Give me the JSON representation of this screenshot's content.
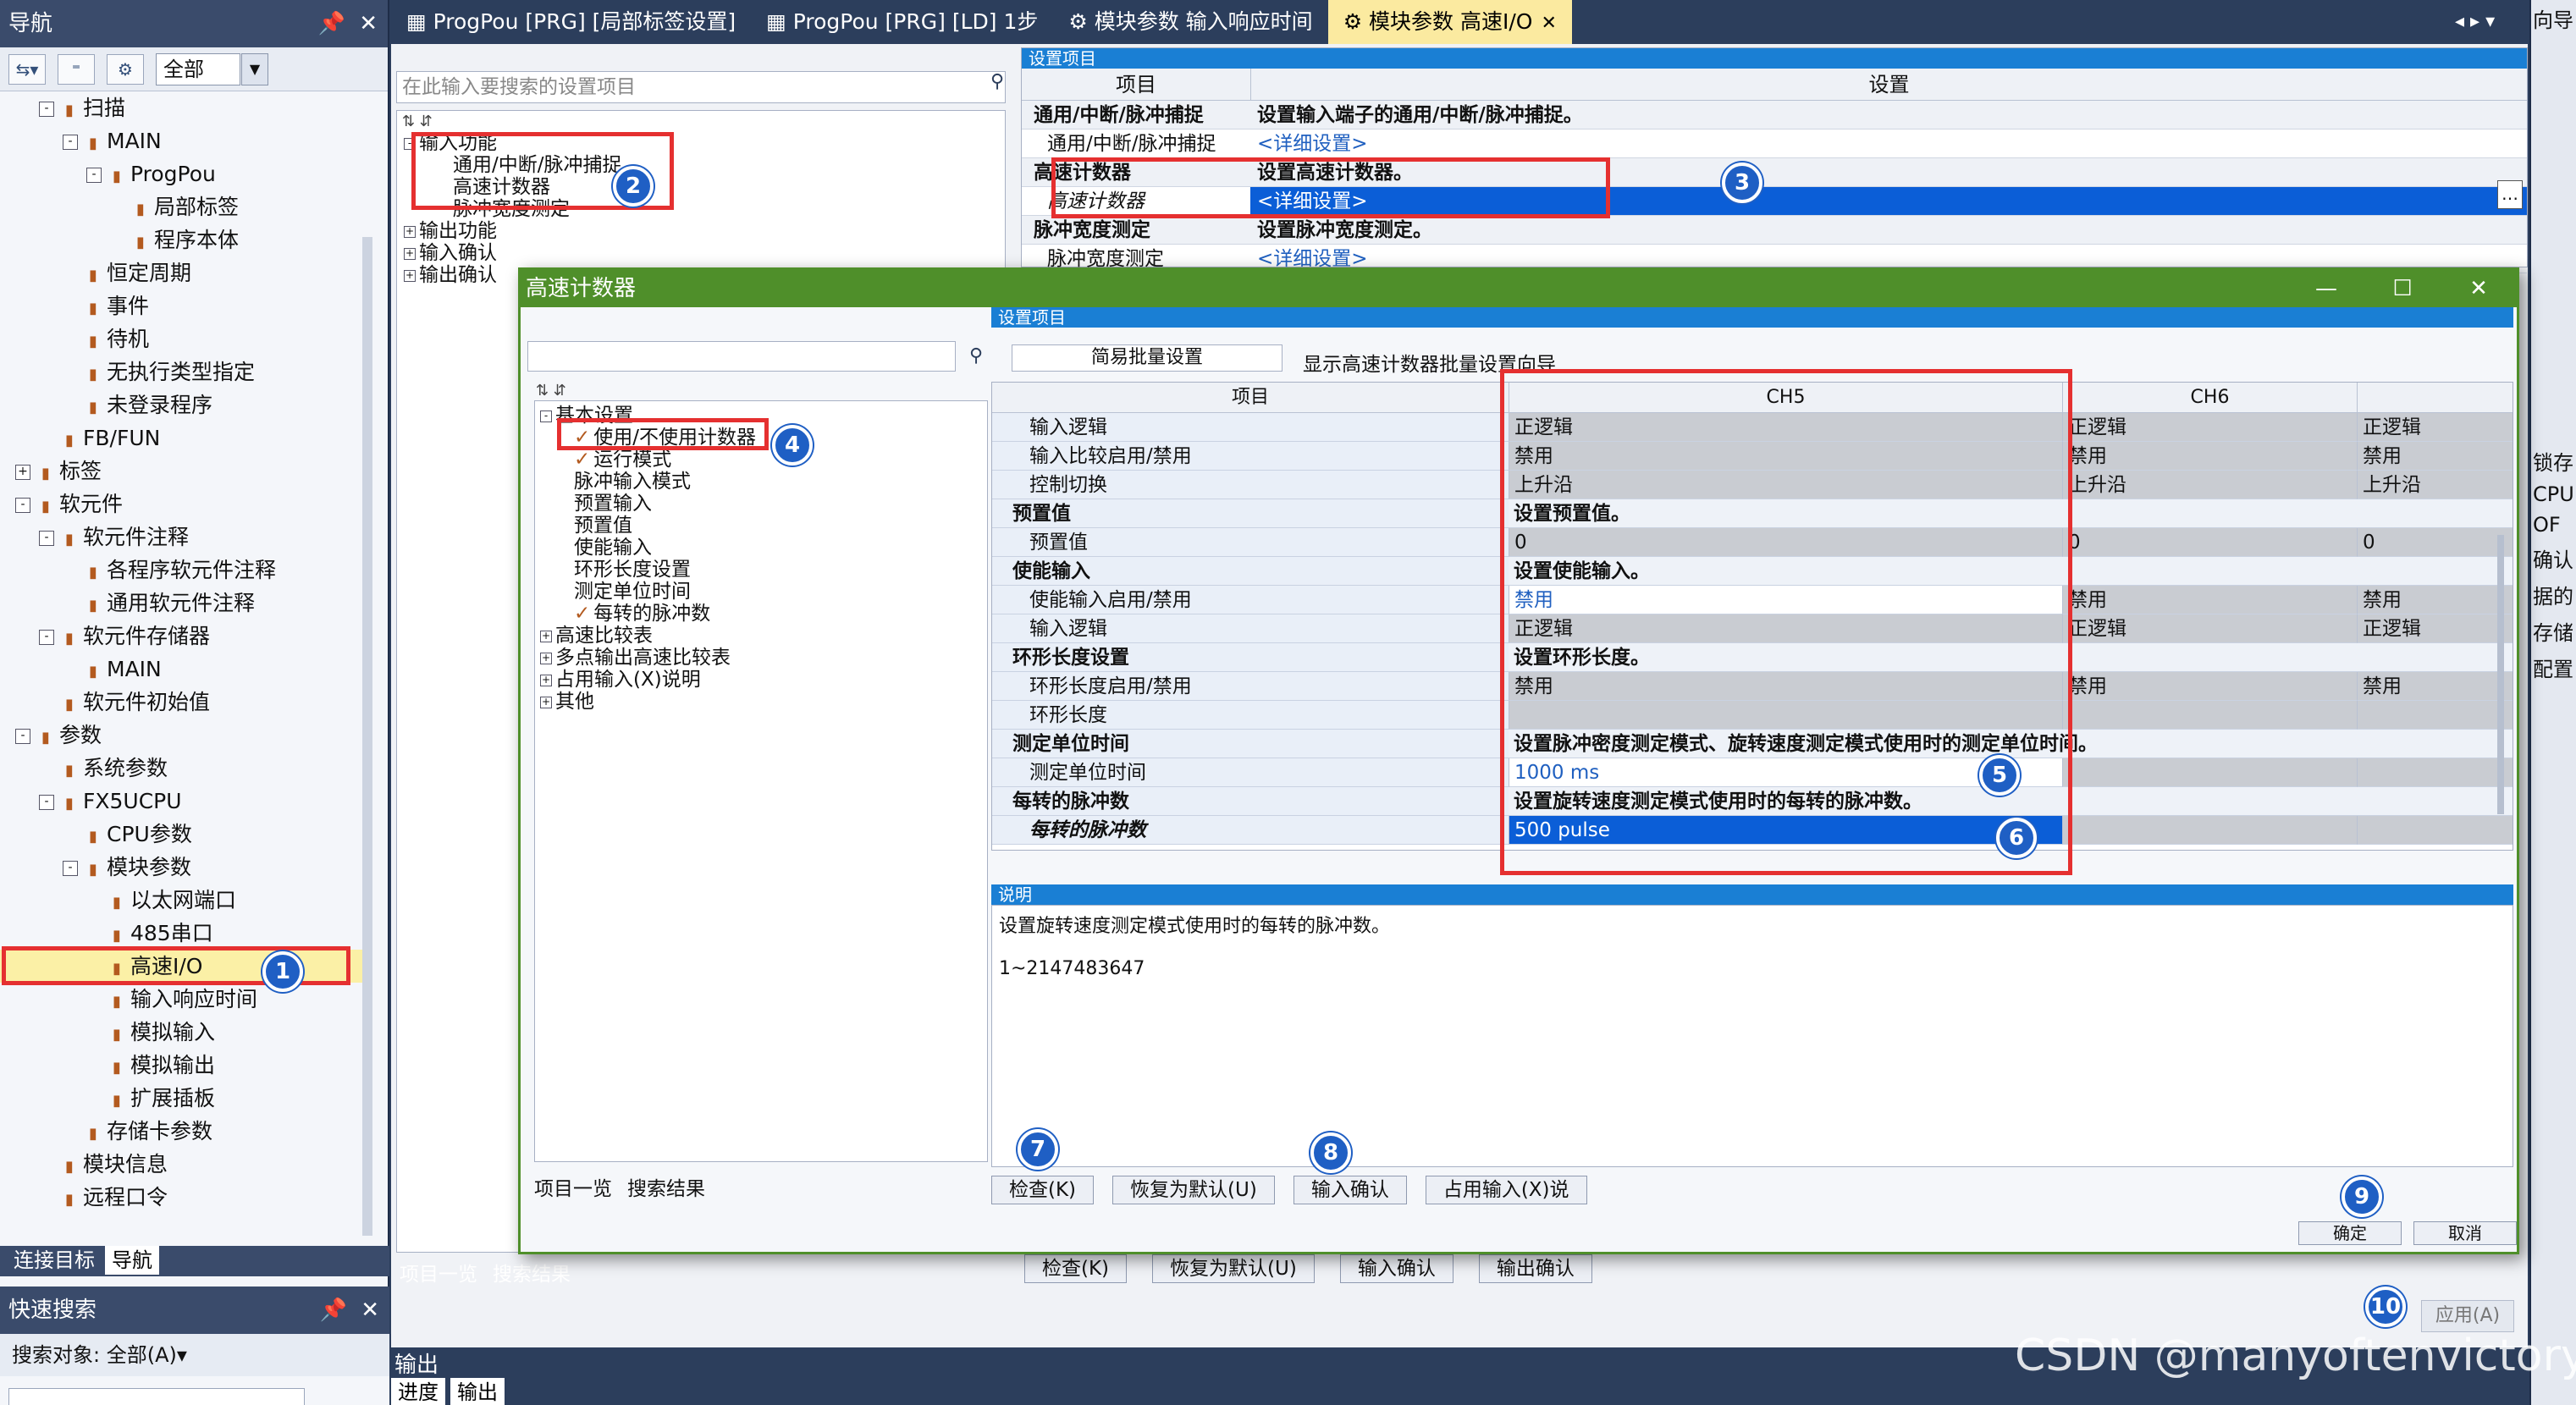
{
  "nav": {
    "title": "导航",
    "filter_value": "全部",
    "tree": [
      {
        "label": "扫描",
        "level": 1,
        "exp": "-"
      },
      {
        "label": "MAIN",
        "level": 2,
        "exp": "-"
      },
      {
        "label": "ProgPou",
        "level": 3,
        "exp": "-"
      },
      {
        "label": "局部标签",
        "level": 4,
        "exp": ""
      },
      {
        "label": "程序本体",
        "level": 4,
        "exp": ""
      },
      {
        "label": "恒定周期",
        "level": 2,
        "exp": ""
      },
      {
        "label": "事件",
        "level": 2,
        "exp": ""
      },
      {
        "label": "待机",
        "level": 2,
        "exp": ""
      },
      {
        "label": "无执行类型指定",
        "level": 2,
        "exp": ""
      },
      {
        "label": "未登录程序",
        "level": 2,
        "exp": ""
      },
      {
        "label": "FB/FUN",
        "level": 1,
        "exp": ""
      },
      {
        "label": "标签",
        "level": 0,
        "exp": "+"
      },
      {
        "label": "软元件",
        "level": 0,
        "exp": "-"
      },
      {
        "label": "软元件注释",
        "level": 1,
        "exp": "-"
      },
      {
        "label": "各程序软元件注释",
        "level": 2,
        "exp": ""
      },
      {
        "label": "通用软元件注释",
        "level": 2,
        "exp": ""
      },
      {
        "label": "软元件存储器",
        "level": 1,
        "exp": "-"
      },
      {
        "label": "MAIN",
        "level": 2,
        "exp": ""
      },
      {
        "label": "软元件初始值",
        "level": 1,
        "exp": ""
      },
      {
        "label": "参数",
        "level": 0,
        "exp": "-"
      },
      {
        "label": "系统参数",
        "level": 1,
        "exp": ""
      },
      {
        "label": "FX5UCPU",
        "level": 1,
        "exp": "-"
      },
      {
        "label": "CPU参数",
        "level": 2,
        "exp": ""
      },
      {
        "label": "模块参数",
        "level": 2,
        "exp": "-"
      },
      {
        "label": "以太网端口",
        "level": 3,
        "exp": ""
      },
      {
        "label": "485串口",
        "level": 3,
        "exp": ""
      },
      {
        "label": "高速I/O",
        "level": 3,
        "exp": "",
        "selected": true
      },
      {
        "label": "输入响应时间",
        "level": 3,
        "exp": ""
      },
      {
        "label": "模拟输入",
        "level": 3,
        "exp": ""
      },
      {
        "label": "模拟输出",
        "level": 3,
        "exp": ""
      },
      {
        "label": "扩展插板",
        "level": 3,
        "exp": ""
      },
      {
        "label": "存储卡参数",
        "level": 2,
        "exp": ""
      },
      {
        "label": "模块信息",
        "level": 1,
        "exp": ""
      },
      {
        "label": "远程口令",
        "level": 1,
        "exp": ""
      }
    ],
    "bottom_tabs": [
      "连接目标",
      "导航"
    ],
    "quick_search_title": "快速搜索",
    "search_target": "搜索对象: 全部(A)▾"
  },
  "tabs": [
    {
      "label": "ProgPou [PRG] [局部标签设置]",
      "active": false
    },
    {
      "label": "ProgPou [PRG] [LD] 1步",
      "active": false
    },
    {
      "label": "模块参数 输入响应时间",
      "active": false
    },
    {
      "label": "模块参数 高速I/O",
      "active": true
    }
  ],
  "base": {
    "search_placeholder": "在此输入要搜索的设置项目",
    "section_label": "设置项目",
    "tree": [
      {
        "label": "输入功能",
        "exp": "-",
        "indent": 0
      },
      {
        "label": "通用/中断/脉冲捕捉",
        "exp": "",
        "indent": 1
      },
      {
        "label": "高速计数器",
        "exp": "",
        "indent": 1
      },
      {
        "label": "脉冲宽度测定",
        "exp": "",
        "indent": 1
      },
      {
        "label": "输出功能",
        "exp": "+",
        "indent": 0
      },
      {
        "label": "输入确认",
        "exp": "+",
        "indent": 0
      },
      {
        "label": "输出确认",
        "exp": "+",
        "indent": 0
      }
    ],
    "grid_header": [
      "项目",
      "设置"
    ],
    "grid_rows": [
      {
        "item": "通用/中断/脉冲捕捉",
        "value": "设置输入端子的通用/中断/脉冲捕捉。",
        "group": true
      },
      {
        "item": "通用/中断/脉冲捕捉",
        "value": "<详细设置>",
        "link": true
      },
      {
        "item": "高速计数器",
        "value": "设置高速计数器。",
        "group": true
      },
      {
        "item": "高速计数器",
        "value": "<详细设置>",
        "link": true,
        "highlight": true
      },
      {
        "item": "脉冲宽度测定",
        "value": "设置脉冲宽度测定。",
        "group": true
      },
      {
        "item": "脉冲宽度测定",
        "value": "<详细设置>",
        "link": true
      }
    ],
    "bottom_tabs": [
      "项目一览",
      "搜索结果"
    ],
    "buttons": [
      "检查(K)",
      "恢复为默认(U)",
      "输入确认",
      "输出确认"
    ],
    "apply": "应用(A)"
  },
  "dialog": {
    "title": "高速计数器",
    "section_label": "设置项目",
    "batch_button": "简易批量设置",
    "batch_text": "显示高速计数器批量设置向导",
    "tree": [
      {
        "label": "基本设置",
        "exp": "-",
        "indent": 0,
        "check": false
      },
      {
        "label": "使用/不使用计数器",
        "exp": "",
        "indent": 1,
        "check": true
      },
      {
        "label": "运行模式",
        "exp": "",
        "indent": 1,
        "check": true
      },
      {
        "label": "脉冲输入模式",
        "exp": "",
        "indent": 1,
        "check": false
      },
      {
        "label": "预置输入",
        "exp": "",
        "indent": 1,
        "check": false
      },
      {
        "label": "预置值",
        "exp": "",
        "indent": 1,
        "check": false
      },
      {
        "label": "使能输入",
        "exp": "",
        "indent": 1,
        "check": false
      },
      {
        "label": "环形长度设置",
        "exp": "",
        "indent": 1,
        "check": false
      },
      {
        "label": "测定单位时间",
        "exp": "",
        "indent": 1,
        "check": false
      },
      {
        "label": "每转的脉冲数",
        "exp": "",
        "indent": 1,
        "check": true
      },
      {
        "label": "高速比较表",
        "exp": "+",
        "indent": 0,
        "check": false
      },
      {
        "label": "多点输出高速比较表",
        "exp": "+",
        "indent": 0,
        "check": false
      },
      {
        "label": "占用输入(X)说明",
        "exp": "+",
        "indent": 0,
        "check": false
      },
      {
        "label": "其他",
        "exp": "+",
        "indent": 0,
        "check": false
      }
    ],
    "bottom_tabs": [
      "项目一览",
      "搜索结果"
    ],
    "grid_header": {
      "item": "项目",
      "ch5": "CH5",
      "ch6": "CH6"
    },
    "grid_rows": [
      {
        "item": "输入逻辑",
        "ch5": "正逻辑",
        "ch6": "正逻辑",
        "ch7": "正逻辑"
      },
      {
        "item": "输入比较启用/禁用",
        "ch5": "禁用",
        "ch6": "禁用",
        "ch7": "禁用"
      },
      {
        "item": "控制切换",
        "ch5": "上升沿",
        "ch6": "上升沿",
        "ch7": "上升沿"
      },
      {
        "item": "预置值",
        "desc": "设置预置值。",
        "group": true
      },
      {
        "item": "预置值",
        "ch5": "0",
        "ch6": "0",
        "ch7": "0"
      },
      {
        "item": "使能输入",
        "desc": "设置使能输入。",
        "group": true
      },
      {
        "item": "使能输入启用/禁用",
        "ch5": "禁用",
        "ch6": "禁用",
        "ch7": "禁用",
        "style": "white"
      },
      {
        "item": "输入逻辑",
        "ch5": "正逻辑",
        "ch6": "正逻辑",
        "ch7": "正逻辑"
      },
      {
        "item": "环形长度设置",
        "desc": "设置环形长度。",
        "group": true
      },
      {
        "item": "环形长度启用/禁用",
        "ch5": "禁用",
        "ch6": "禁用",
        "ch7": "禁用"
      },
      {
        "item": "环形长度",
        "ch5": "",
        "ch6": "",
        "ch7": ""
      },
      {
        "item": "测定单位时间",
        "desc": "设置脉冲密度测定模式、旋转速度测定模式使用时的测定单位时间。",
        "group": true
      },
      {
        "item": "测定单位时间",
        "ch5": "1000 ms",
        "ch6": "",
        "ch7": "",
        "style": "white"
      },
      {
        "item": "每转的脉冲数",
        "desc": "设置旋转速度测定模式使用时的每转的脉冲数。",
        "group": true
      },
      {
        "item": "每转的脉冲数",
        "ch5": "500 pulse",
        "ch6": "",
        "ch7": "",
        "style": "blue",
        "italic": true
      }
    ],
    "desc_label": "说明",
    "desc_line1": "设置旋转速度测定模式使用时的每转的脉冲数。",
    "desc_line2": "1~2147483647",
    "buttons": [
      "检查(K)",
      "恢复为默认(U)",
      "输入确认",
      "占用输入(X)说"
    ],
    "ok": "确定",
    "cancel": "取消"
  },
  "output": {
    "title": "输出",
    "tabs": [
      "进度",
      "输出"
    ]
  },
  "right_panel": {
    "lines": [
      "向导",
      "锁存",
      "CPU",
      "OF",
      "确认",
      "据的",
      "存储",
      "配置"
    ]
  },
  "badges": [
    "1",
    "2",
    "3",
    "4",
    "5",
    "6",
    "7",
    "8",
    "9",
    "10"
  ],
  "watermark": "CSDN @manyoftenvictory"
}
